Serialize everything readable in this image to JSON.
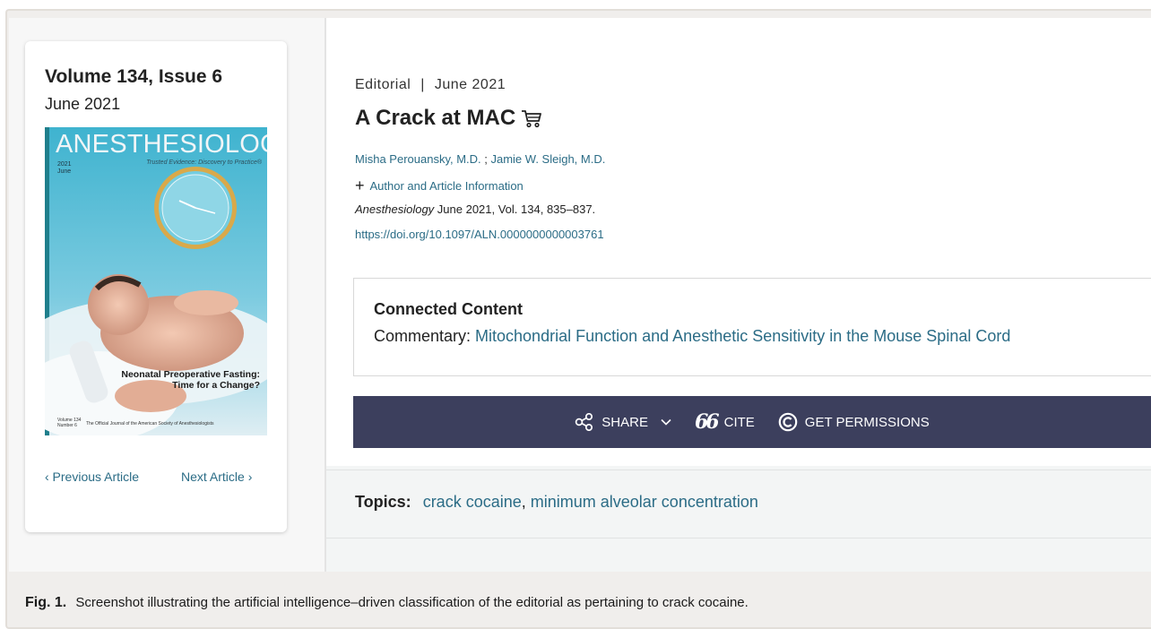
{
  "issue": {
    "volume_label": "Volume 134, Issue 6",
    "date": "June 2021",
    "cover": {
      "title": "ANESTHESIOLOGY",
      "subtitle": "Trusted Evidence: Discovery to Practice®",
      "year": "2021",
      "month": "June",
      "headline_1": "Neonatal Preoperative Fasting:",
      "headline_2": "Time for a Change?",
      "volume_no_1": "Volume 134",
      "volume_no_2": "Number 6",
      "journal_line": "The Official Journal of the American Society of Anesthesiologists"
    },
    "prev_label": "‹ Previous Article",
    "next_label": "Next Article ›"
  },
  "article": {
    "type": "Editorial",
    "separator": "|",
    "date": "June 2021",
    "title": "A Crack at MAC",
    "authors": [
      "Misha Perouansky, M.D.",
      "Jamie W. Sleigh, M.D."
    ],
    "author_separator": " ; ",
    "author_info_label": "Author and Article Information",
    "citation_journal": "Anesthesiology",
    "citation_rest": " June 2021, Vol. 134, 835–837.",
    "doi": "https://doi.org/10.1097/ALN.0000000000003761"
  },
  "connected_content": {
    "heading": "Connected Content",
    "prefix": "Commentary: ",
    "link": "Mitochondrial Function and Anesthetic Sensitivity in the Mouse Spinal Cord"
  },
  "toolbar": {
    "share_label": "SHARE",
    "cite_label": "CITE",
    "permissions_label": "GET PERMISSIONS"
  },
  "topics": {
    "label": "Topics:",
    "items": [
      "crack cocaine",
      "minimum alveolar concentration"
    ]
  },
  "caption": {
    "label": "Fig. 1.",
    "text": "Screenshot illustrating the artificial intelligence–driven classification of the editorial as pertaining to crack cocaine."
  },
  "colors": {
    "link": "#2b6c86",
    "toolbar_bg": "#3c3f5d",
    "cover_bg": "#49b8cf"
  }
}
